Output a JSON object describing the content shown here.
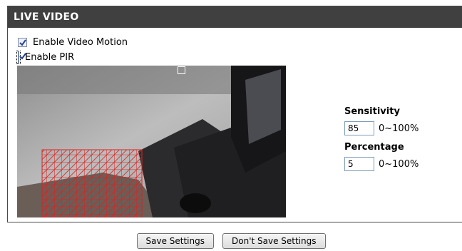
{
  "panel": {
    "title": "LIVE VIDEO"
  },
  "options": {
    "motion_label": "Enable Video Motion",
    "motion_checked": true,
    "pir_label": "Enable PIR",
    "pir_checked": true
  },
  "settings": {
    "sensitivity_label": "Sensitivity",
    "sensitivity_value": "85",
    "sensitivity_range": "0~100%",
    "percentage_label": "Percentage",
    "percentage_value": "5",
    "percentage_range": "0~100%"
  },
  "buttons": {
    "save": "Save Settings",
    "dont_save": "Don't Save Settings"
  },
  "colors": {
    "header_bg": "#404040",
    "motion_grid": "#e02020"
  }
}
